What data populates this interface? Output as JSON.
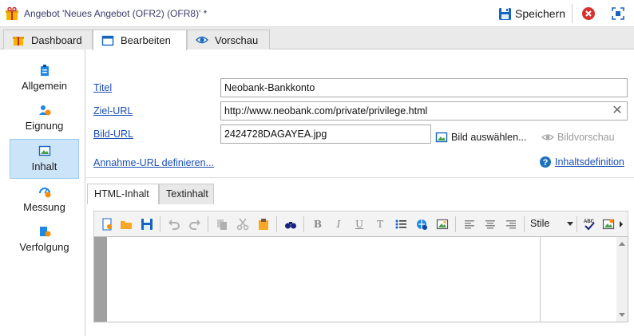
{
  "window": {
    "title": "Angebot 'Neues Angebot (OFR2) (OFR8)' *",
    "save_label": "Speichern"
  },
  "tabs": [
    {
      "label": "Dashboard",
      "icon": "dashboard-icon"
    },
    {
      "label": "Bearbeiten",
      "icon": "edit-window-icon",
      "active": true
    },
    {
      "label": "Vorschau",
      "icon": "eye-icon"
    }
  ],
  "sidebar": {
    "items": [
      {
        "label": "Allgemein",
        "icon": "clipboard-icon"
      },
      {
        "label": "Eignung",
        "icon": "users-icon"
      },
      {
        "label": "Inhalt",
        "icon": "picture-icon",
        "active": true
      },
      {
        "label": "Messung",
        "icon": "gauge-icon"
      },
      {
        "label": "Verfolgung",
        "icon": "tracking-icon"
      }
    ]
  },
  "form": {
    "title_label": "Titel",
    "title_value": "Neobank-Bankkonto",
    "url_label": "Ziel-URL",
    "url_value": "http://www.neobank.com/private/privilege.html",
    "image_label": "Bild-URL",
    "image_value": "2424728DAGAYEA.jpg",
    "select_image": "Bild auswählen...",
    "image_preview": "Bildvorschau",
    "accept_url": "Annahme-URL definieren...",
    "content_def": "Inhaltsdefinition"
  },
  "editor": {
    "tabs": [
      "HTML-Inhalt",
      "Textinhalt"
    ],
    "styles_label": "Stile",
    "toolbar_glyphs": {
      "bold": "B",
      "italic": "I",
      "underline": "U",
      "clear_format": "T"
    }
  },
  "colors": {
    "link": "#1a4fb4",
    "accent": "#1565c0",
    "active_bg": "#cce4f7",
    "close_red": "#d93030"
  }
}
